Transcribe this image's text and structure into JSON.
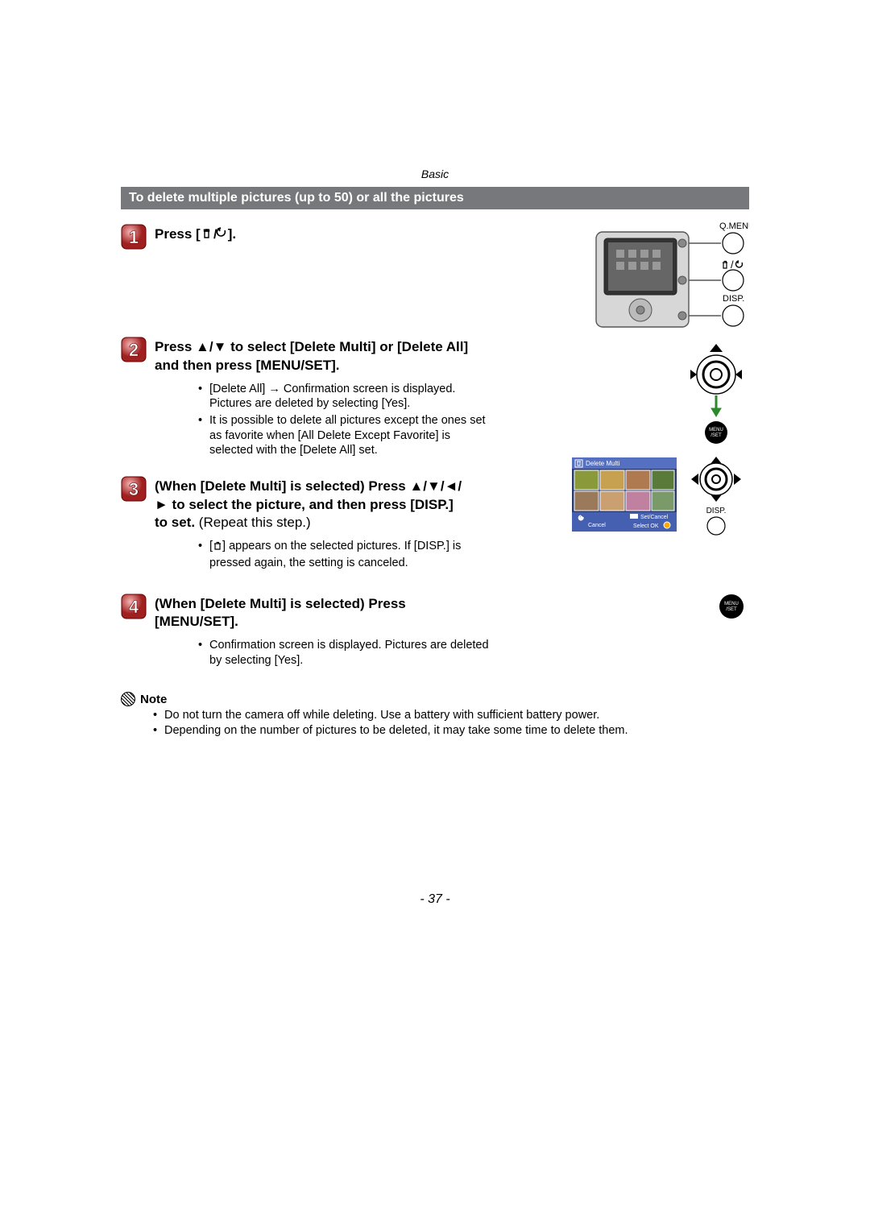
{
  "breadcrumb": "Basic",
  "section_title": "To delete multiple pictures (up to 50) or all the pictures",
  "steps": {
    "s1": {
      "title_prefix": "Press [",
      "title_suffix": "]."
    },
    "s2": {
      "title": "Press ▲/▼ to select [Delete Multi] or [Delete All] and then press [MENU/SET].",
      "b1": "[Delete All] → Confirmation screen is displayed. Pictures are deleted by selecting [Yes].",
      "b2": "It is possible to delete all pictures except the ones set as favorite when [All Delete Except Favorite] is selected with the [Delete All] set."
    },
    "s3": {
      "title_a": "(When [Delete Multi] is selected) Press ▲/▼/◄/► to select the picture, and then press [DISP.] to set. ",
      "title_b": "(Repeat this step.)",
      "b1a": "[",
      "b1b": "] appears on the selected pictures. If [DISP.] is pressed again, the setting is canceled."
    },
    "s4": {
      "title": "(When [Delete Multi] is selected) Press [MENU/SET].",
      "b1": "Confirmation screen is displayed. Pictures are deleted by selecting [Yes]."
    }
  },
  "note": {
    "head": "Note",
    "n1": "Do not turn the camera off while deleting. Use a battery with sufficient battery power.",
    "n2": "Depending on the number of pictures to be deleted, it may take some time to delete them."
  },
  "labels": {
    "qmenu": "Q.MENU",
    "disp": "DISP.",
    "menu": "MENU",
    "set": "/SET",
    "delete_multi": "Delete Multi",
    "set_cancel": "Set/Cancel",
    "select_ok": "Select    OK",
    "cancel": "Cancel"
  },
  "page_number": "- 37 -"
}
